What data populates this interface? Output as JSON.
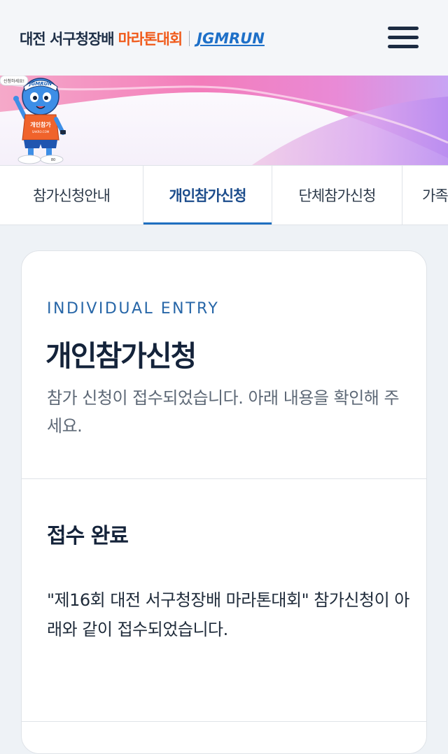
{
  "header": {
    "logo_main": "대전 서구청장배",
    "logo_accent": "마라톤대회",
    "logo_brand": "JGMRUN",
    "menu_icon": "hamburger-menu-icon"
  },
  "banner": {
    "mascot_speech": "신청하세요!",
    "mascot_cap": "JGMRUN",
    "mascot_shirt": "개인참가",
    "mascot_shirt_sub": "SAKRO.COM",
    "mascot_shoe": "80"
  },
  "tabs": [
    {
      "label": "참가신청안내",
      "active": false
    },
    {
      "label": "개인참가신청",
      "active": true
    },
    {
      "label": "단체참가신청",
      "active": false
    },
    {
      "label": "가족",
      "active": false
    }
  ],
  "card": {
    "eyebrow": "INDIVIDUAL ENTRY",
    "title": "개인참가신청",
    "description": "참가 신청이 접수되었습니다. 아래 내용을 확인해 주세요.",
    "section_title": "접수 완료",
    "message": "\"제16회 대전 서구청장배 마라톤대회\" 참가신청이 아래와 같이 접수되었습니다."
  },
  "colors": {
    "accent_blue": "#1f6fc0",
    "logo_orange": "#f05a1a",
    "dark_navy": "#14233a",
    "banner_pink": "#f06dc0",
    "banner_purple": "#c79af2"
  }
}
